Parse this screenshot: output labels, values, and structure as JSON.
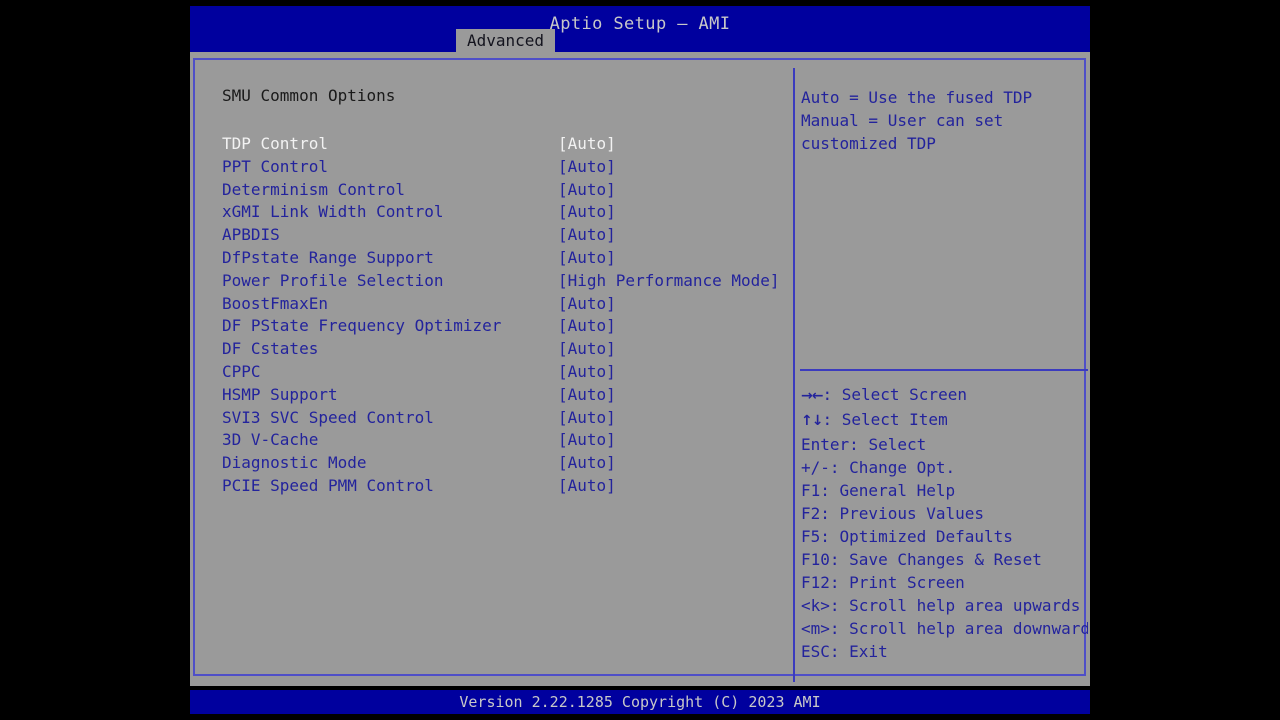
{
  "header": {
    "title": "Aptio Setup – AMI",
    "active_tab": "Advanced",
    "tabs": [
      "Advanced"
    ]
  },
  "colors": {
    "screen_bg": "#000000",
    "panel_bg": "#9a9a9a",
    "bar_blue": "#00009e",
    "text_blue": "#23239c",
    "text_selected": "#f2f2f2",
    "border_blue": "#4f4fc8",
    "heading": "#1a1a1a"
  },
  "main": {
    "section_heading": "SMU Common Options",
    "options": [
      {
        "label": "TDP Control",
        "value": "[Auto]",
        "selected": true
      },
      {
        "label": "PPT Control",
        "value": "[Auto]",
        "selected": false
      },
      {
        "label": "Determinism Control",
        "value": "[Auto]",
        "selected": false
      },
      {
        "label": "xGMI Link Width Control",
        "value": "[Auto]",
        "selected": false
      },
      {
        "label": "APBDIS",
        "value": "[Auto]",
        "selected": false
      },
      {
        "label": "DfPstate Range Support",
        "value": "[Auto]",
        "selected": false
      },
      {
        "label": "Power Profile Selection",
        "value": "[High Performance Mode]",
        "selected": false
      },
      {
        "label": "BoostFmaxEn",
        "value": "[Auto]",
        "selected": false
      },
      {
        "label": "DF PState Frequency Optimizer",
        "value": "[Auto]",
        "selected": false
      },
      {
        "label": "DF Cstates",
        "value": "[Auto]",
        "selected": false
      },
      {
        "label": "CPPC",
        "value": "[Auto]",
        "selected": false
      },
      {
        "label": "HSMP Support",
        "value": "[Auto]",
        "selected": false
      },
      {
        "label": "SVI3 SVC Speed Control",
        "value": "[Auto]",
        "selected": false
      },
      {
        "label": "3D V-Cache",
        "value": "[Auto]",
        "selected": false
      },
      {
        "label": "Diagnostic Mode",
        "value": "[Auto]",
        "selected": false
      },
      {
        "label": "PCIE Speed PMM Control",
        "value": "[Auto]",
        "selected": false
      }
    ]
  },
  "help": {
    "description_lines": [
      "Auto = Use the fused TDP",
      "Manual = User can set",
      "customized TDP"
    ],
    "legend": [
      {
        "key": "→←",
        "key_is_arrow": true,
        "text": ": Select Screen"
      },
      {
        "key": "↑↓",
        "key_is_arrow": true,
        "text": ": Select Item"
      },
      {
        "key": "Enter",
        "key_is_arrow": false,
        "text": ": Select"
      },
      {
        "key": "+/-",
        "key_is_arrow": false,
        "text": ": Change Opt."
      },
      {
        "key": "F1",
        "key_is_arrow": false,
        "text": ": General Help"
      },
      {
        "key": "F2",
        "key_is_arrow": false,
        "text": ": Previous Values"
      },
      {
        "key": "F5",
        "key_is_arrow": false,
        "text": ": Optimized Defaults"
      },
      {
        "key": "F10",
        "key_is_arrow": false,
        "text": ": Save Changes & Reset"
      },
      {
        "key": "F12",
        "key_is_arrow": false,
        "text": ": Print Screen"
      },
      {
        "key": "<k>",
        "key_is_arrow": false,
        "text": ": Scroll help area upwards"
      },
      {
        "key": "<m>",
        "key_is_arrow": false,
        "text": ": Scroll help area downwards"
      },
      {
        "key": "ESC",
        "key_is_arrow": false,
        "text": ": Exit"
      }
    ]
  },
  "footer": {
    "version_text": "Version 2.22.1285 Copyright (C) 2023 AMI"
  }
}
